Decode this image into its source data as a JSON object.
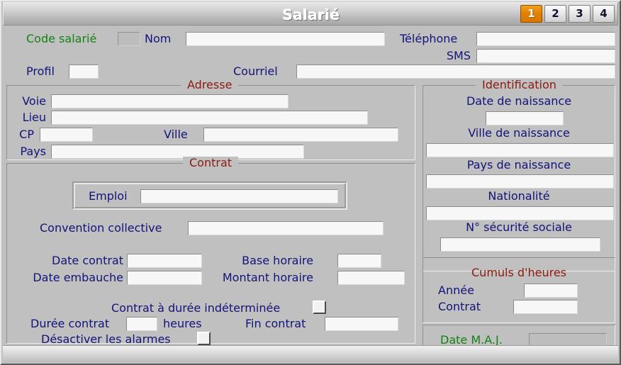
{
  "window": {
    "title": "Salarié",
    "tabs": [
      {
        "label": "1",
        "active": true
      },
      {
        "label": "2",
        "active": false
      },
      {
        "label": "3",
        "active": false
      },
      {
        "label": "4",
        "active": false
      }
    ]
  },
  "colors": {
    "label_blue": "#13137a",
    "label_green": "#128312",
    "legend_red": "#8b1a10",
    "tab_active_orange": "#e08000",
    "window_bg": "#c0c0c0",
    "field_bg": "#f7f7f7",
    "field_disabled_bg": "#bdbdbd"
  },
  "header": {
    "code_salarie_label": "Code salarié",
    "code_salarie_value": "",
    "nom_label": "Nom",
    "nom_value": "",
    "telephone_label": "Téléphone",
    "telephone_value": "",
    "sms_label": "SMS",
    "sms_value": "",
    "profil_label": "Profil",
    "profil_value": "",
    "courriel_label": "Courriel",
    "courriel_value": ""
  },
  "adresse": {
    "legend": "Adresse",
    "voie_label": "Voie",
    "voie_value": "",
    "lieu_label": "Lieu",
    "lieu_value": "",
    "cp_label": "CP",
    "cp_value": "",
    "ville_label": "Ville",
    "ville_value": "",
    "pays_label": "Pays",
    "pays_value": ""
  },
  "contrat": {
    "legend": "Contrat",
    "emploi_label": "Emploi",
    "emploi_value": "",
    "convention_label": "Convention collective",
    "convention_value": "",
    "date_contrat_label": "Date contrat",
    "date_contrat_value": "",
    "date_embauche_label": "Date embauche",
    "date_embauche_value": "",
    "base_horaire_label": "Base horaire",
    "base_horaire_value": "",
    "montant_horaire_label": "Montant horaire",
    "montant_horaire_value": "",
    "cdi_label": "Contrat à durée indéterminée",
    "cdi_checked": false,
    "duree_label": "Durée contrat",
    "duree_value": "",
    "heures_label": "heures",
    "fin_contrat_label": "Fin contrat",
    "fin_contrat_value": "",
    "desactiver_alarmes_label": "Désactiver les alarmes",
    "desactiver_alarmes_checked": false
  },
  "identification": {
    "legend": "Identification",
    "date_naissance_label": "Date de naissance",
    "date_naissance_value": "",
    "ville_naissance_label": "Ville de naissance",
    "ville_naissance_value": "",
    "pays_naissance_label": "Pays de naissance",
    "pays_naissance_value": "",
    "nationalite_label": "Nationalité",
    "nationalite_value": "",
    "num_secu_label": "N° sécurité sociale",
    "num_secu_value": ""
  },
  "cumuls": {
    "legend": "Cumuls d'heures",
    "annee_label": "Année",
    "annee_value": "",
    "contrat_label": "Contrat",
    "contrat_value": ""
  },
  "maj": {
    "label": "Date M.A.J.",
    "value": ""
  }
}
